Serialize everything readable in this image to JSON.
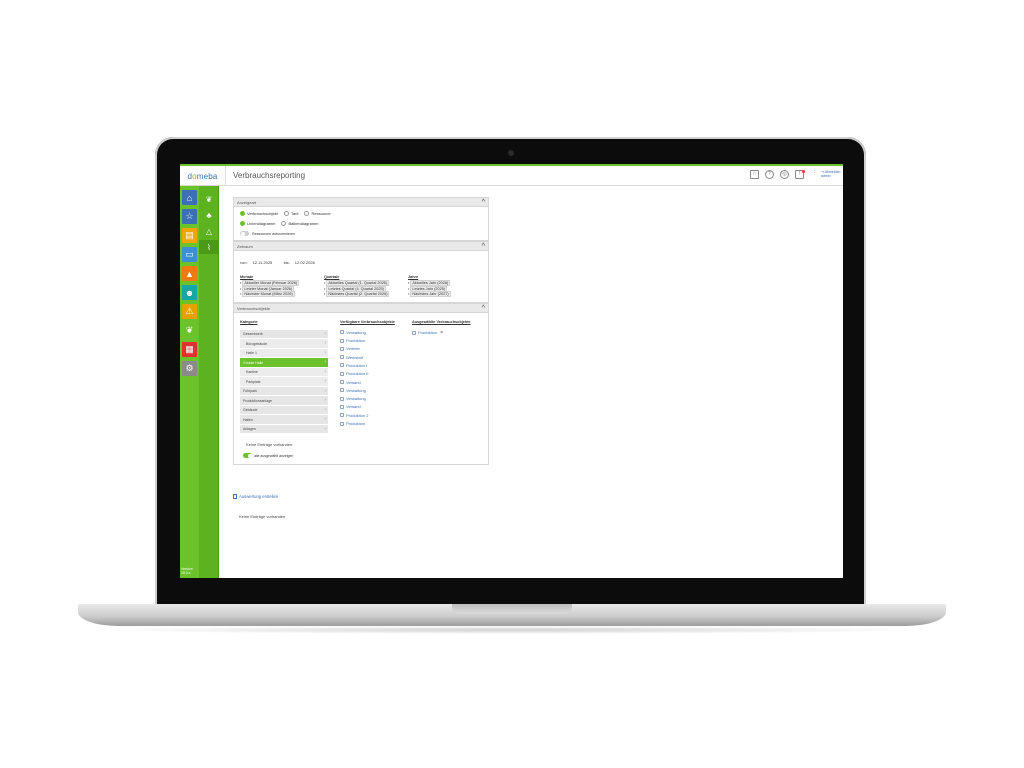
{
  "app": {
    "logo_prefix": "d",
    "logo_o": "o",
    "logo_suffix": "meba",
    "page_title": "Verbrauchsreporting",
    "logout_label": "Abmelden",
    "logout_sub": "admin",
    "version_line1": "Version",
    "version_line2": "15.0.x"
  },
  "topbar_icons": [
    "star-icon",
    "help-icon",
    "support-icon",
    "bell-icon",
    "more-icon",
    "logout-icon"
  ],
  "rail": {
    "items": [
      {
        "name": "home-icon",
        "glyph": "⌂",
        "color": "#3b6fb6"
      },
      {
        "name": "star-icon",
        "glyph": "☆",
        "color": "#3b6fb6"
      },
      {
        "name": "document-icon",
        "glyph": "▤",
        "color": "#f0a500"
      },
      {
        "name": "laptop-icon",
        "glyph": "▭",
        "color": "#3b8fd6"
      },
      {
        "name": "graduation-icon",
        "glyph": "▲",
        "color": "#f07a10"
      },
      {
        "name": "person-icon",
        "glyph": "☻",
        "color": "#17a6a6"
      },
      {
        "name": "warning-icon",
        "glyph": "⚠",
        "color": "#e8a000"
      },
      {
        "name": "leaf-icon",
        "glyph": "❦",
        "color": "#6cc22a"
      },
      {
        "name": "report-icon",
        "glyph": "▦",
        "color": "#e03030"
      },
      {
        "name": "settings-icon",
        "glyph": "⚙",
        "color": "#8a8a8a"
      }
    ]
  },
  "subrail": {
    "items": [
      {
        "name": "leaf-sub-icon",
        "glyph": "❦",
        "active": false
      },
      {
        "name": "people-icon",
        "glyph": "♣",
        "active": false
      },
      {
        "name": "triangle-icon",
        "glyph": "△",
        "active": false
      },
      {
        "name": "chart-icon",
        "glyph": "⌇",
        "active": true
      }
    ]
  },
  "panel_auswahl": {
    "title": "Anzeigeart",
    "radios_row1": [
      {
        "label": "Verbrauchsobjekt",
        "checked": true
      },
      {
        "label": "Tarif",
        "checked": false
      },
      {
        "label": "Ressource",
        "checked": false
      }
    ],
    "radios_row2": [
      {
        "label": "Liniendiagramm",
        "checked": true
      },
      {
        "label": "Balkendiagramm",
        "checked": false
      }
    ],
    "toggle_label": "Ressourcen aufsummieren",
    "toggle_on": false
  },
  "panel_zeitraum": {
    "title": "Zeitraum",
    "von_label": "von:",
    "von_value": "12.11.2025",
    "bis_label": "bis:",
    "bis_value": "12.02.2026",
    "monate_title": "Monate",
    "monate": [
      "Aktueller Monat (Februar 2026)",
      "Letzter Monat (Januar 2026)",
      "Nächster Monat (März 2026)"
    ],
    "quartale_title": "Quartale",
    "quartale": [
      "Aktuelles Quartal (1. Quartal 2026)",
      "Letztes Quartal (4. Quartal 2025)",
      "Nächstes Quartal (2. Quartal 2026)"
    ],
    "jahre_title": "Jahre",
    "jahre": [
      "Aktuelles Jahr (2026)",
      "Letztes Jahr (2025)",
      "Nächstes Jahr (2027)"
    ]
  },
  "panel_verbrauch": {
    "title": "Verbrauchsobjekte",
    "kategorie_title": "Kategorie",
    "kategorien": [
      {
        "label": "Gesamtwerk",
        "sub": false,
        "active": false
      },
      {
        "label": "Bürogebäude",
        "sub": true,
        "active": false
      },
      {
        "label": "Halle 1",
        "sub": true,
        "active": false
      },
      {
        "label": "Grosse Halle",
        "sub": false,
        "active": true
      },
      {
        "label": "Kantine",
        "sub": true,
        "active": false
      },
      {
        "label": "Parkplatz",
        "sub": true,
        "active": false
      },
      {
        "label": "Fuhrpark",
        "sub": false,
        "active": false
      },
      {
        "label": "Produktionsanlage",
        "sub": false,
        "active": false
      },
      {
        "label": "Gebäude",
        "sub": false,
        "active": false
      },
      {
        "label": "Hallen",
        "sub": false,
        "active": false
      },
      {
        "label": "Anlagen",
        "sub": false,
        "active": false
      }
    ],
    "verfuegbar_title": "Verfügbare Verbrauchsobjekte",
    "verfuegbar": [
      "Verwaltung",
      "Produktion",
      "Vertrieb",
      "Werkstatt",
      "Produktion I",
      "Produktion II",
      "Versand",
      "Verwaltung",
      "Verwaltung",
      "Versand",
      "Produktion 2",
      "Produktion"
    ],
    "ausgewaehlt_title": "Ausgewählte Verbrauchsobjekte",
    "ausgewaehlt": [
      "Produktion"
    ],
    "empty_note": "Keine Einträge vorhanden",
    "all_toggle_label": "alle ausgewählt anzeigen",
    "all_toggle_on": true
  },
  "auswertung": {
    "label": "Auswertung erstellen",
    "empty_note": "Keine Einträge vorhanden"
  }
}
